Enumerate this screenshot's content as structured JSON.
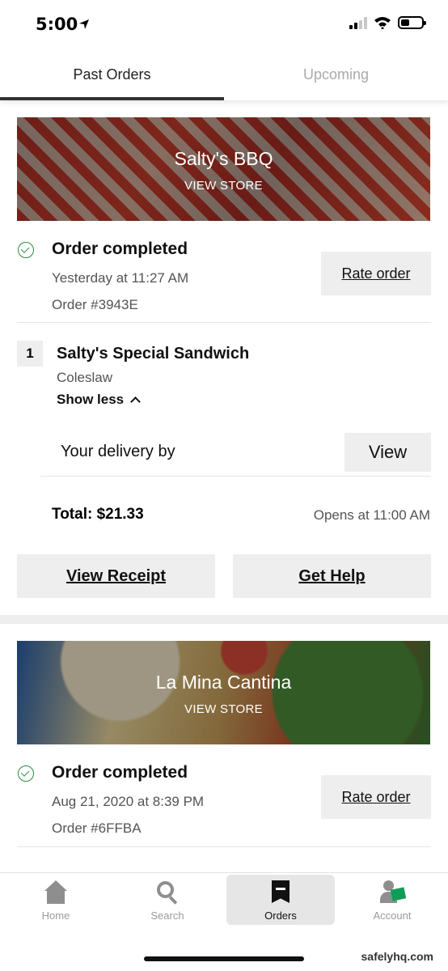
{
  "status_bar": {
    "time": "5:00"
  },
  "tabs": [
    {
      "label": "Past Orders",
      "active": true
    },
    {
      "label": "Upcoming",
      "active": false
    }
  ],
  "orders": [
    {
      "store_name": "Salty's BBQ",
      "view_store_label": "VIEW STORE",
      "status": "Order completed",
      "date": "Yesterday at 11:27 AM",
      "order_number": "Order #3943E",
      "rate_label": "Rate order",
      "item": {
        "quantity": "1",
        "name": "Salty's Special Sandwich",
        "option": "Coleslaw"
      },
      "show_less_label": "Show less",
      "delivery_label": "Your delivery by",
      "view_label": "View",
      "total": "Total: $21.33",
      "opens": "Opens at 11:00 AM",
      "receipt_label": "View Receipt",
      "help_label": "Get Help"
    },
    {
      "store_name": "La Mina Cantina",
      "view_store_label": "VIEW STORE",
      "status": "Order completed",
      "date": "Aug 21, 2020 at 8:39 PM",
      "order_number": "Order #6FFBA",
      "rate_label": "Rate order"
    }
  ],
  "bottom_nav": [
    {
      "label": "Home",
      "icon": "home-icon",
      "active": false
    },
    {
      "label": "Search",
      "icon": "search-icon",
      "active": false
    },
    {
      "label": "Orders",
      "icon": "receipt-icon",
      "active": true
    },
    {
      "label": "Account",
      "icon": "account-icon",
      "active": false
    }
  ],
  "watermark": "safelyhq.com",
  "colors": {
    "check_green": "#2a8b3e",
    "button_gray": "#eeeeee"
  }
}
